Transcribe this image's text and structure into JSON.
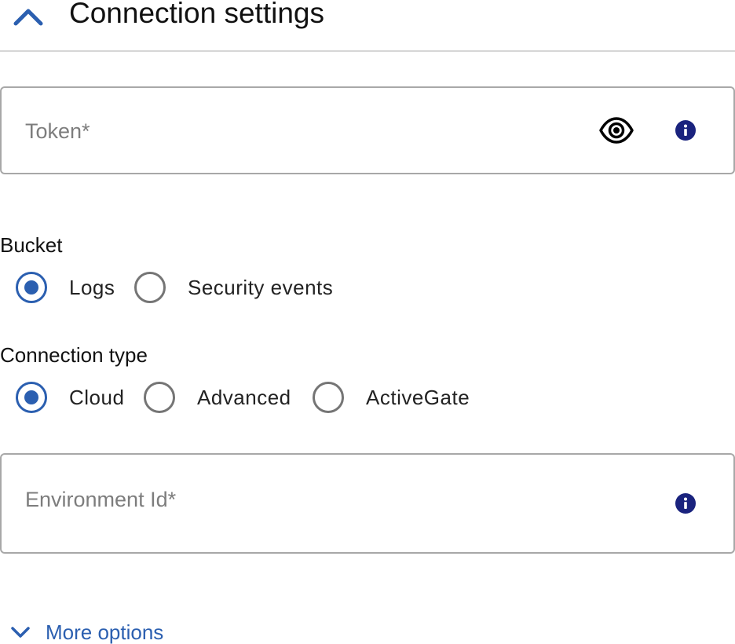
{
  "header": {
    "title": "Connection settings",
    "collapse_icon": "chevron-up-icon"
  },
  "token_field": {
    "placeholder": "Token*",
    "value": "",
    "visibility_icon": "eye-icon",
    "info_icon": "info-icon"
  },
  "bucket": {
    "label": "Bucket",
    "options": [
      {
        "label": "Logs",
        "checked": true
      },
      {
        "label": "Security events",
        "checked": false
      }
    ]
  },
  "connection_type": {
    "label": "Connection type",
    "options": [
      {
        "label": "Cloud",
        "checked": true
      },
      {
        "label": "Advanced",
        "checked": false
      },
      {
        "label": "ActiveGate",
        "checked": false
      }
    ]
  },
  "environment_field": {
    "placeholder": "Environment Id*",
    "value": "",
    "info_icon": "info-icon"
  },
  "more_options": {
    "label": "More options",
    "icon": "chevron-down-icon"
  },
  "colors": {
    "accent": "#2b5fb0",
    "info_icon": "#1a237e",
    "border": "#a8a8a8",
    "divider": "#d6d6d6"
  }
}
